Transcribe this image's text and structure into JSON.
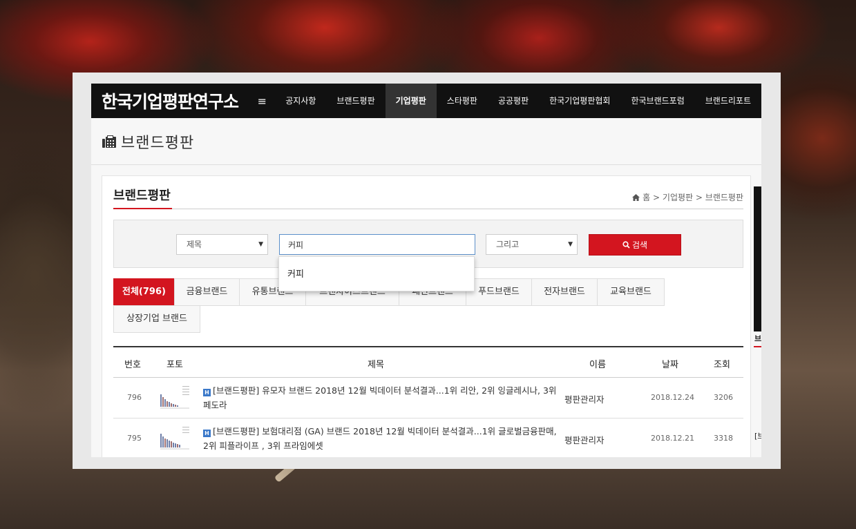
{
  "site": {
    "logo": "한국기업평판연구소",
    "menu_icon": "≡",
    "nav": [
      {
        "label": "공지사항",
        "active": false
      },
      {
        "label": "브랜드평판",
        "active": false
      },
      {
        "label": "기업평판",
        "active": true
      },
      {
        "label": "스타평판",
        "active": false
      },
      {
        "label": "공공평판",
        "active": false
      },
      {
        "label": "한국기업평판협회",
        "active": false
      },
      {
        "label": "한국브랜드포럼",
        "active": false
      },
      {
        "label": "브랜드리포트",
        "active": false
      }
    ]
  },
  "page_header": {
    "title": "브랜드평판",
    "icon": "phone-icon"
  },
  "section": {
    "title": "브랜드평판",
    "breadcrumb": {
      "home": "홈",
      "sep": ">",
      "level1": "기업평판",
      "level2": "브랜드평판"
    }
  },
  "search": {
    "field_select": "제목",
    "query": "커피",
    "operator_select": "그리고",
    "button_label": "검색",
    "autocomplete": [
      "커피"
    ]
  },
  "tabs": [
    {
      "label": "전체(796)",
      "active": true
    },
    {
      "label": "금융브랜드",
      "active": false
    },
    {
      "label": "유통브랜드",
      "active": false
    },
    {
      "label": "프랜차이즈브랜드",
      "active": false
    },
    {
      "label": "패션브랜드",
      "active": false
    },
    {
      "label": "푸드브랜드",
      "active": false
    },
    {
      "label": "전자브랜드",
      "active": false
    },
    {
      "label": "교육브랜드",
      "active": false
    },
    {
      "label": "상장기업 브랜드",
      "active": false
    }
  ],
  "table": {
    "headers": {
      "num": "번호",
      "photo": "포토",
      "title": "제목",
      "author": "이름",
      "date": "날짜",
      "views": "조회"
    },
    "badge": "H",
    "rows": [
      {
        "num": "796",
        "title": "[브랜드평판] 유모자 브랜드 2018년 12월 빅데이터 분석결과...1위 리안, 2위 잉글레시나, 3위 페도라",
        "author": "평판관리자",
        "date": "2018.12.24",
        "views": "3206"
      },
      {
        "num": "795",
        "title": "[브랜드평판] 보험대리점 (GA) 브랜드 2018년 12월 빅데이터 분석결과...1위 글로벌금융판매, 2위 피플라이프 , 3위 프라임에셋",
        "author": "평판관리자",
        "date": "2018.12.21",
        "views": "3318"
      }
    ]
  },
  "sidebar": {
    "fragment_1": "브",
    "fragment_2": "[브"
  }
}
